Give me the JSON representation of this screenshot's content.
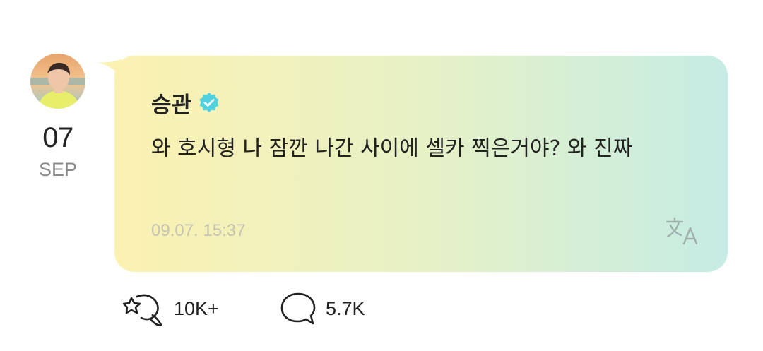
{
  "post": {
    "author": "승관",
    "date_day": "07",
    "date_month": "SEP",
    "message": "와 호시형 나 잠깐 나간 사이에 셀카 찍은거야? 와 진짜",
    "timestamp": "09.07. 15:37"
  },
  "actions": {
    "likes": "10K+",
    "comments": "5.7K"
  },
  "icons": {
    "verified": "verified-badge-icon",
    "translate": "translate-icon",
    "like": "star-like-icon",
    "comment": "comment-bubble-icon"
  },
  "colors": {
    "bubble_start": "#fbf1b1",
    "bubble_end": "#c5ece4",
    "verified": "#4fd1e0",
    "timestamp": "#c5c3b3",
    "month": "#8a8a8a"
  }
}
